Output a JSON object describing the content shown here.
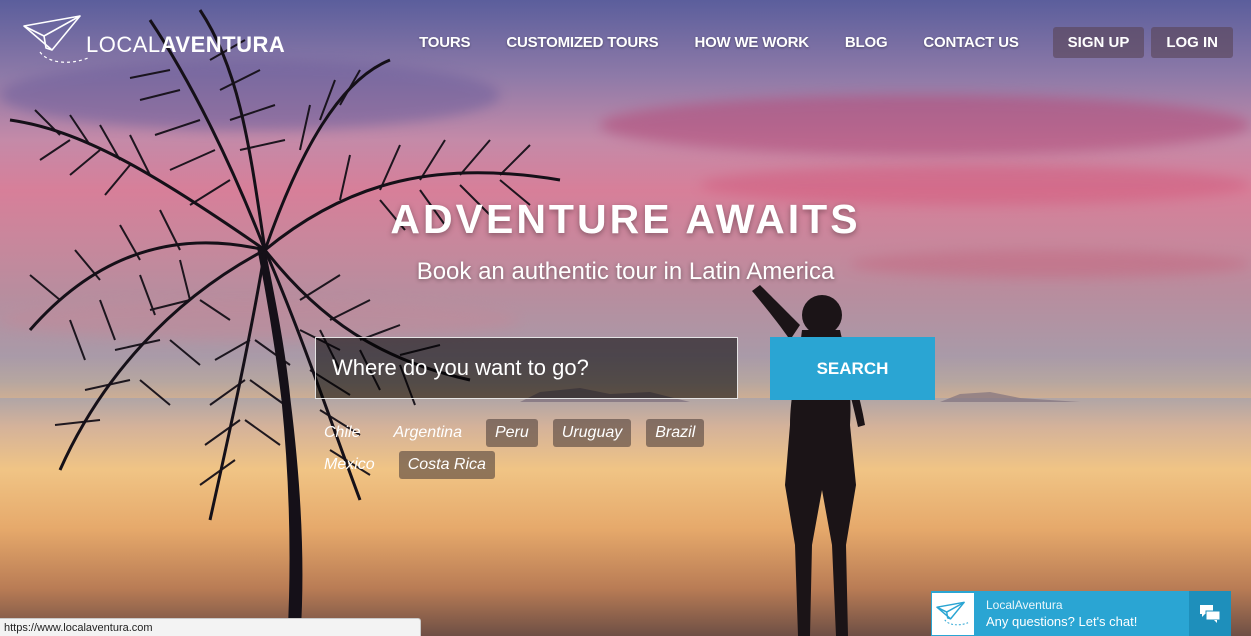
{
  "brand": {
    "logo_light": "LOCAL",
    "logo_bold": "AVENTURA"
  },
  "nav": {
    "links": [
      "TOURS",
      "CUSTOMIZED TOURS",
      "HOW WE WORK",
      "BLOG",
      "CONTACT US"
    ],
    "signup_label": "SIGN UP",
    "login_label": "LOG IN"
  },
  "hero": {
    "title": "ADVENTURE AWAITS",
    "subtitle": "Book an authentic tour in Latin America"
  },
  "search": {
    "placeholder": "Where do you want to go?",
    "button_label": "SEARCH"
  },
  "countries": {
    "row1": [
      "Chile",
      "Argentina",
      "Peru",
      "Uruguay",
      "Brazil"
    ],
    "row2": [
      "Mexico",
      "Costa Rica"
    ]
  },
  "status_bar": {
    "url": "https://www.localaventura.com"
  },
  "chat": {
    "title": "LocalAventura",
    "subtitle": "Any questions? Let's chat!"
  },
  "colors": {
    "accent": "#2aa5d3",
    "chat_dark": "#1e8fbb"
  },
  "icons": {
    "logo": "paper-plane-icon",
    "chat": "chat-bubbles-icon"
  }
}
